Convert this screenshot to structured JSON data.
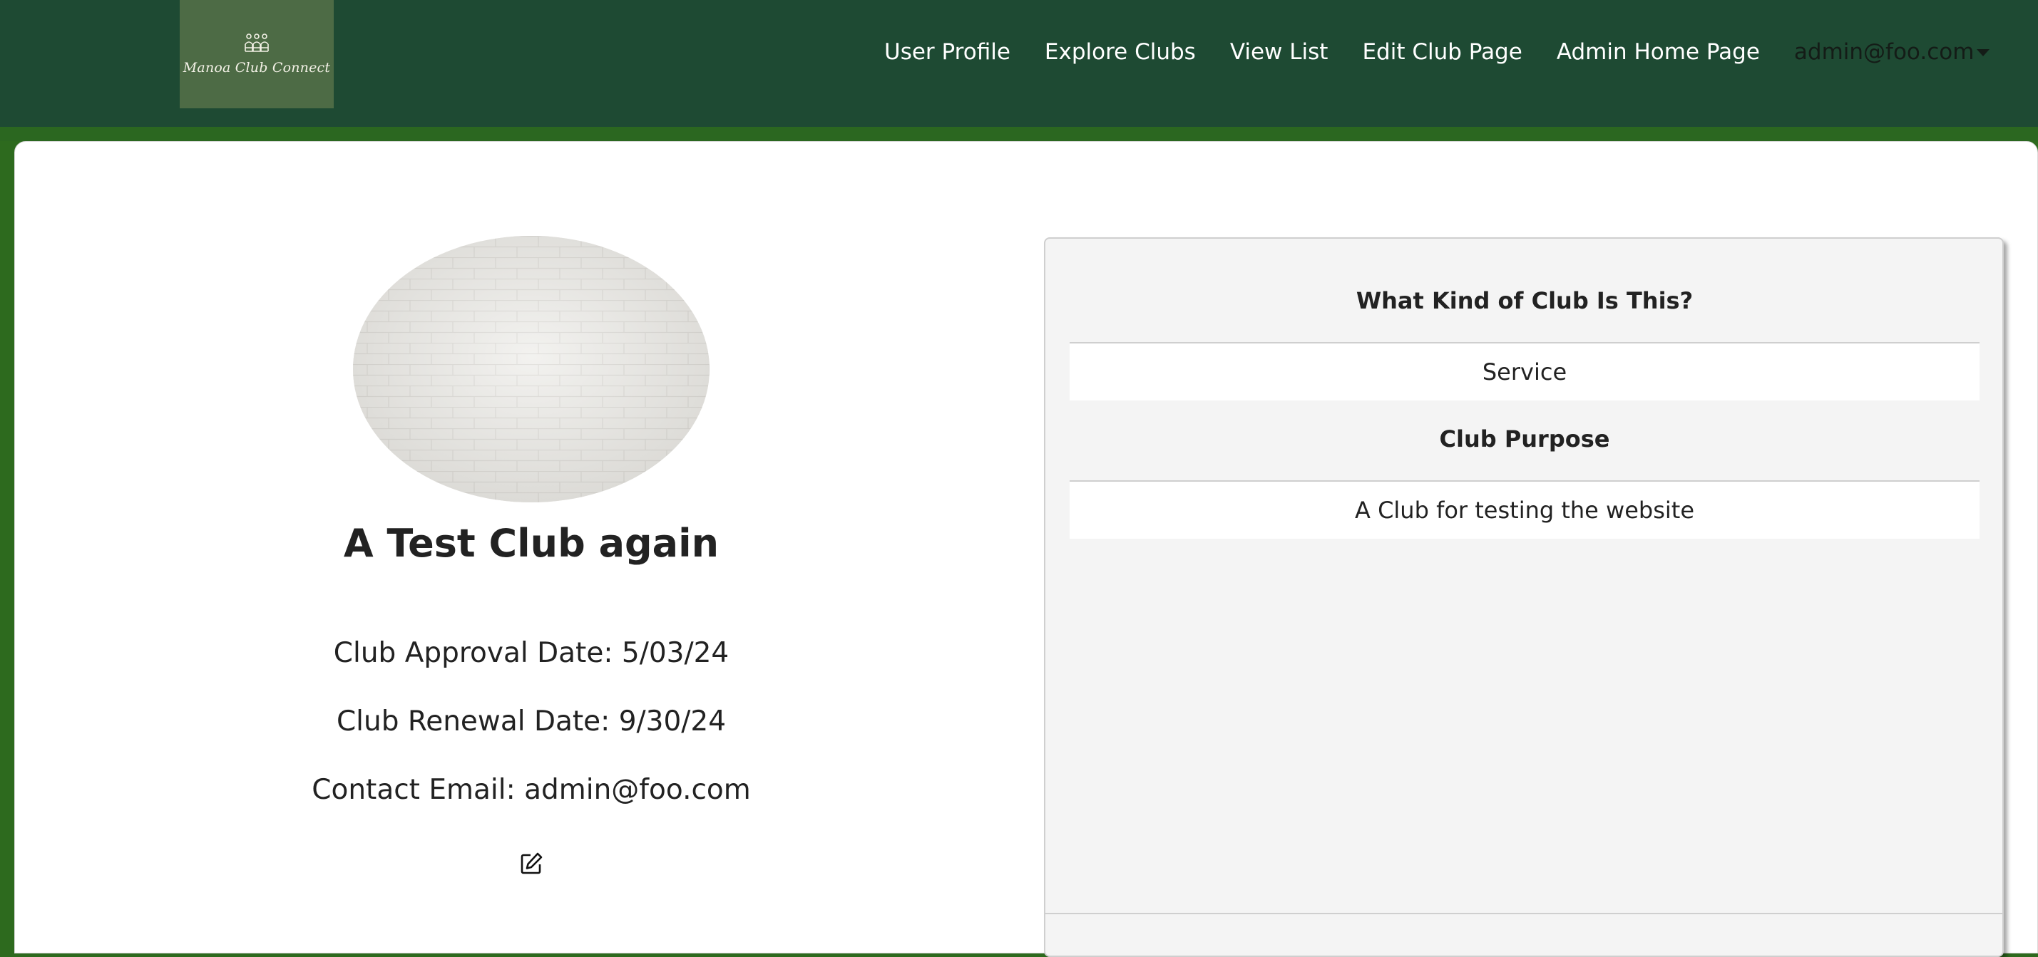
{
  "navbar": {
    "logo_text": "Manoa Club Connect",
    "links": {
      "user_profile": "User Profile",
      "explore_clubs": "Explore Clubs",
      "view_list": "View List",
      "edit_club_page": "Edit Club Page",
      "admin_home_page": "Admin Home Page"
    },
    "user_menu": "admin@foo.com"
  },
  "club": {
    "name": "A Test Club again",
    "approval_date": "Club Approval Date: 5/03/24",
    "renewal_date": "Club Renewal Date: 9/30/24",
    "contact_email": "Contact Email: admin@foo.com",
    "photo_icon": "brick-wall-photo",
    "edit_icon": "edit-icon"
  },
  "details": {
    "kind_heading": "What Kind of Club Is This?",
    "kind_value": "Service",
    "purpose_heading": "Club Purpose",
    "purpose_value": "A Club for testing the website"
  },
  "colors": {
    "navbar": "#1e4a33",
    "page_background": "#2d6a1e",
    "logo_background": "#4d6b45",
    "panel_background": "#f4f4f4"
  }
}
